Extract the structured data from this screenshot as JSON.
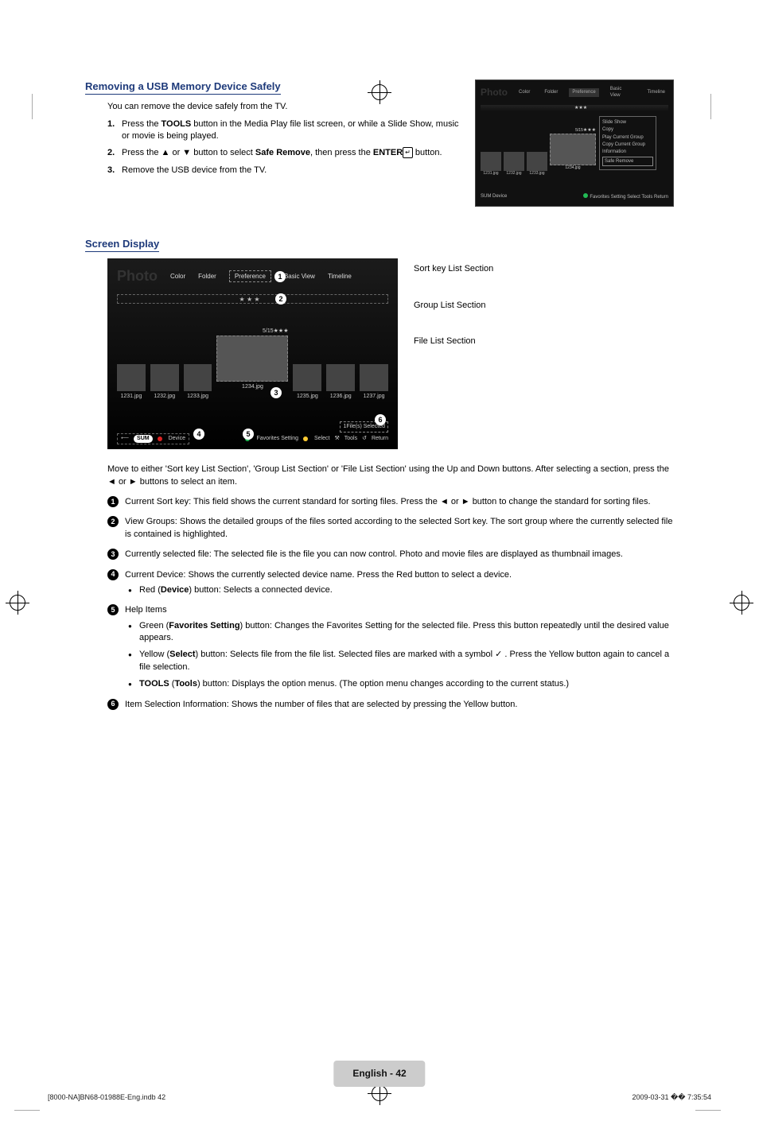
{
  "section1": {
    "heading": "Removing a USB Memory Device Safely",
    "intro": "You can remove the device safely from the TV.",
    "steps": [
      {
        "num": "1.",
        "pre": "Press the ",
        "bold1": "TOOLS",
        "post": " button in the Media Play file list screen, or while a Slide Show, music or movie is being played."
      },
      {
        "num": "2.",
        "pre": "Press the ▲ or ▼ button to select ",
        "bold1": "Safe Remove",
        "mid": ", then press the ",
        "bold2": "ENTER",
        "post": " button."
      },
      {
        "num": "3.",
        "pre": "Remove the USB device from the TV.",
        "bold1": "",
        "post": ""
      }
    ]
  },
  "tv_small": {
    "title": "Photo",
    "tabs": [
      "Color",
      "Folder",
      "Preference",
      "Basic View",
      "Timeline"
    ],
    "counter": "5/15",
    "stars": "★★★",
    "files": [
      "1231.jpg",
      "1232.jpg",
      "1233.jpg",
      "1234.jpg"
    ],
    "menu": [
      "Slide Show",
      "Copy",
      "Play Current Group",
      "Copy Current Group",
      "Information",
      "Safe Remove"
    ],
    "bottom_left": "SUM    Device",
    "bottom_right": "Favorites Setting   Select   Tools   Return"
  },
  "section2": {
    "heading": "Screen Display",
    "tabs": {
      "photo": "Photo",
      "color": "Color",
      "folder": "Folder",
      "pref": "Preference",
      "basic": "Basic View",
      "time": "Timeline"
    },
    "stars": "★ ★ ★",
    "counter": "5/15★★★",
    "files": [
      "1231.jpg",
      "1232.jpg",
      "1233.jpg",
      "1234.jpg",
      "1235.jpg",
      "1236.jpg",
      "1237.jpg"
    ],
    "selected": "1File(s) Selected",
    "bottom": {
      "sum": "SUM",
      "device": "Device",
      "fav": "Favorites Setting",
      "select": "Select",
      "tools": "Tools",
      "return": "Return"
    },
    "labels": {
      "sort": "Sort key List Section",
      "group": "Group List Section",
      "file": "File List Section"
    }
  },
  "body": {
    "intro": "Move to either 'Sort key List Section', 'Group List Section' or 'File List Section' using the Up and Down buttons. After selecting a section, press the ◄ or ► buttons to select an item.",
    "items": [
      {
        "n": "1",
        "text": "Current Sort key: This field shows the current standard for sorting files. Press the ◄ or ► button to change the standard for sorting files."
      },
      {
        "n": "2",
        "text": "View Groups: Shows the detailed groups of the files sorted according to the selected Sort key. The sort group where the currently selected file is contained is highlighted."
      },
      {
        "n": "3",
        "text": "Currently selected file: The selected file is the file you can now control. Photo and movie files are displayed as thumbnail images."
      },
      {
        "n": "4",
        "text": "Current Device: Shows the currently selected device name. Press the Red button to select a device.",
        "bullets": [
          {
            "pre": "Red (",
            "b": "Device",
            "post": ") button: Selects a connected device."
          }
        ]
      },
      {
        "n": "5",
        "text": "Help Items",
        "bullets": [
          {
            "pre": "Green (",
            "b": "Favorites Setting",
            "post": ") button: Changes the Favorites Setting for the selected file. Press this button repeatedly until the desired value appears."
          },
          {
            "pre": "Yellow (",
            "b": "Select",
            "post": ") button: Selects file from the file list. Selected files are marked with a symbol ✓ . Press the Yellow button again to cancel a file selection."
          },
          {
            "pre": "",
            "b": "TOOLS",
            "mid": " (",
            "b2": "Tools",
            "post": ") button: Displays the option menus. (The option menu changes according to the current status.)"
          }
        ]
      },
      {
        "n": "6",
        "text": "Item Selection Information: Shows the number of files that are selected by pressing the Yellow button."
      }
    ]
  },
  "page_label": "English - 42",
  "footer_left": "[8000-NA]BN68-01988E-Eng.indb   42",
  "footer_right": "2009-03-31   �� 7:35:54"
}
